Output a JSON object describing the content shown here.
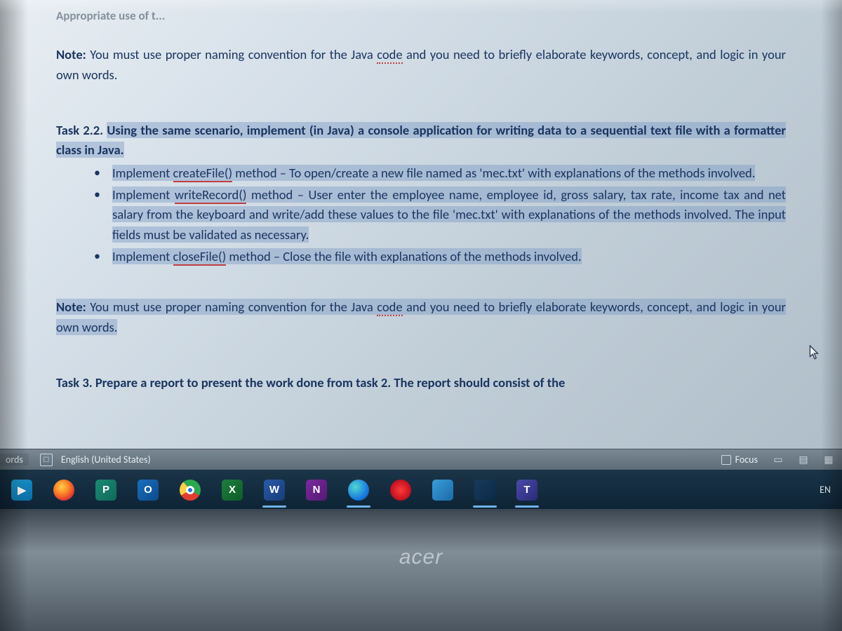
{
  "document": {
    "truncated_top": "Appropriate use of t...",
    "note1_label": "Note:",
    "note1_text_a": " You must use proper naming convention for the Java ",
    "note1_code_word": "code",
    "note1_text_b": " and you need to briefly elaborate keywords, concept, and logic in your own words.",
    "task22_label": "Task 2.2. ",
    "task22_title_a": "Using the same scenario, implement (in Java) a console application for writing data to a sequential text file with a formatter class in Java.",
    "bullets": [
      {
        "lead": "Implement ",
        "method": "createFile()",
        "rest": " method – To open/create a new file named as 'mec.txt' with explanations of the methods involved."
      },
      {
        "lead": "Implement ",
        "method": "writeRecord()",
        "rest": " method – User enter the  employee name, employee id, gross salary, tax rate, income tax and net salary from the keyboard and write/add these values to the file 'mec.txt' with explanations of the methods involved. The input fields must be validated as necessary."
      },
      {
        "lead": "Implement ",
        "method": "closeFile()",
        "rest": " method – Close the file with explanations of the methods involved."
      }
    ],
    "note2_label": "Note:",
    "note2_text_a": " You must use proper naming convention for the Java ",
    "note2_code_word": "code",
    "note2_text_b": " and you need to briefly elaborate keywords, concept, and logic in your own words.",
    "task3_truncated": "Task 3. Prepare a report to present the work done from task 2. The report should consist of the"
  },
  "statusbar": {
    "words_label": "ords",
    "language": "English (United States)",
    "focus_label": "Focus"
  },
  "taskbar": {
    "items": [
      {
        "name": "media-app",
        "letter": "▶",
        "bg": "linear-gradient(135deg,#1fa0d8,#0a6aa3)",
        "active": false
      },
      {
        "name": "firefox",
        "letter": "",
        "bg": "radial-gradient(circle at 40% 35%,#ffcf4a 0%,#ff8a2a 35%,#e23a2e 70%,#4a2ab0 100%)",
        "active": false,
        "round": true
      },
      {
        "name": "publisher",
        "letter": "P",
        "bg": "linear-gradient(135deg,#1b8a74,#0f6a58)",
        "active": false
      },
      {
        "name": "outlook",
        "letter": "O",
        "bg": "linear-gradient(135deg,#1a6fc0,#0d4a8a)",
        "active": false
      },
      {
        "name": "chrome",
        "letter": "",
        "bg": "conic-gradient(from 120deg,#e23c2e 0 120deg,#ffcf4a 120deg 200deg,#2aa84f 200deg 360deg)",
        "active": false,
        "round": true,
        "inner": true
      },
      {
        "name": "excel",
        "letter": "X",
        "bg": "linear-gradient(135deg,#1e7e3e,#0f5a28)",
        "active": false
      },
      {
        "name": "word",
        "letter": "W",
        "bg": "linear-gradient(135deg,#2a5aa8,#163d78)",
        "active": true
      },
      {
        "name": "onenote",
        "letter": "N",
        "bg": "linear-gradient(135deg,#7a2a9e,#541a72)",
        "active": false
      },
      {
        "name": "edge",
        "letter": "",
        "bg": "radial-gradient(circle at 35% 35%,#4fd8d0 0%,#1a7ee0 60%,#0b4a9e 100%)",
        "active": true,
        "round": true
      },
      {
        "name": "opera",
        "letter": "",
        "bg": "radial-gradient(circle at 50% 50%,#ff3a3a 0%,#c01020 70%)",
        "active": false,
        "round": true
      },
      {
        "name": "store",
        "letter": "",
        "bg": "linear-gradient(135deg,#3a9ed8,#1a6aa8)",
        "active": false
      },
      {
        "name": "geometry-app",
        "letter": "",
        "bg": "linear-gradient(135deg,#1a3a5a,#0a2a48)",
        "active": true
      },
      {
        "name": "teams",
        "letter": "T",
        "bg": "linear-gradient(135deg,#4a4aa8,#2a2a7a)",
        "active": true
      }
    ],
    "lang_indicator": "EN"
  },
  "laptop": {
    "brand": "acer"
  }
}
